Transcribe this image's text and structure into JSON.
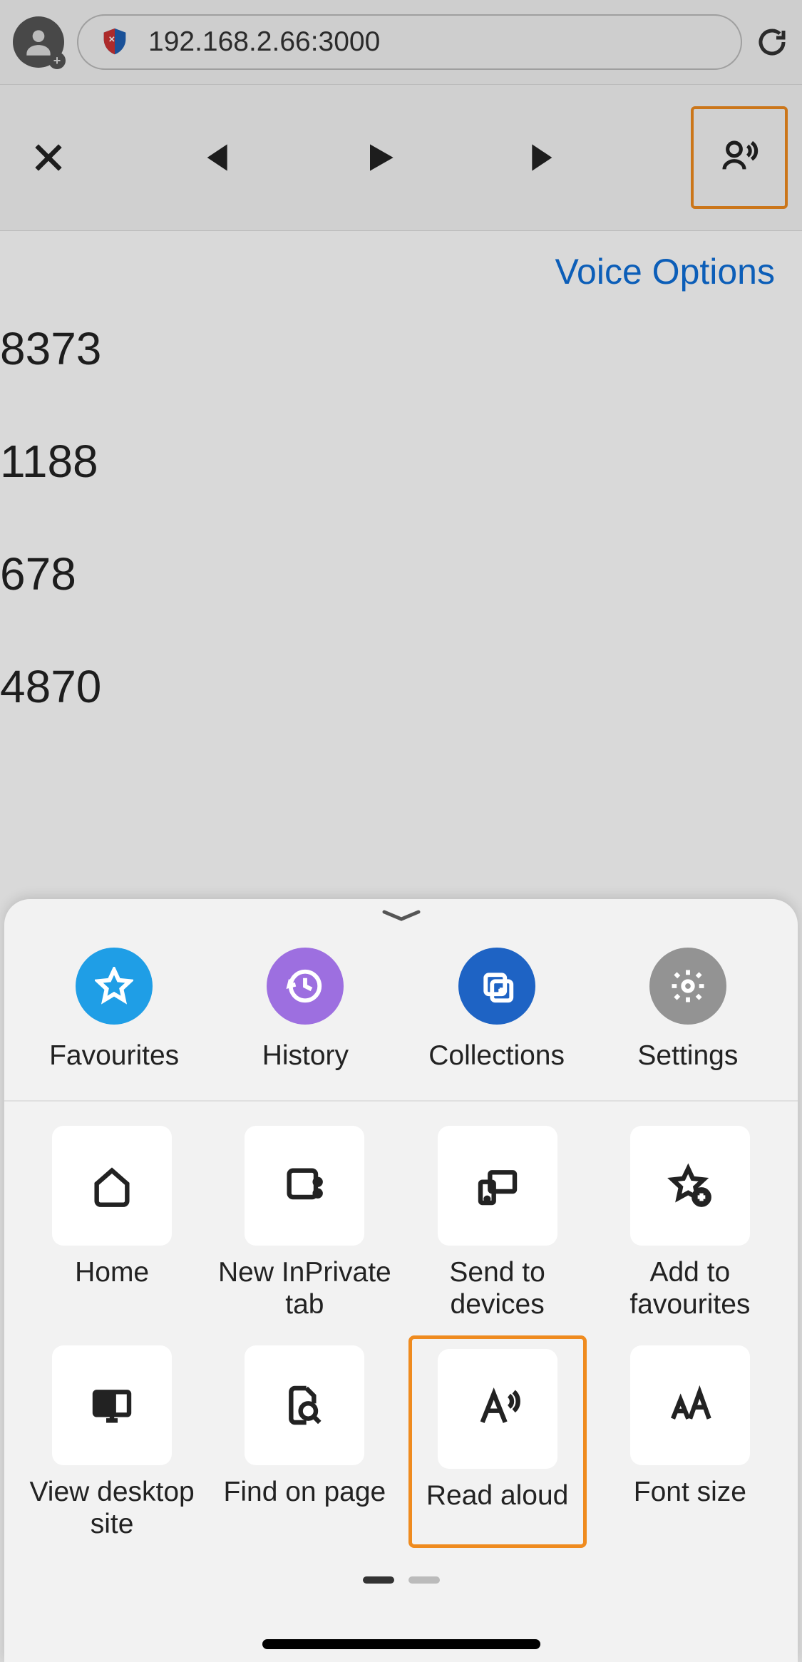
{
  "address_bar": {
    "url": "192.168.2.66:3000"
  },
  "voice_options_label": "Voice Options",
  "page_numbers": [
    "8373",
    "1188",
    "678",
    "4870"
  ],
  "top_row": {
    "favourites": "Favourites",
    "history": "History",
    "collections": "Collections",
    "settings": "Settings"
  },
  "grid": {
    "home": "Home",
    "new_inprivate": "New InPrivate tab",
    "send_devices": "Send to devices",
    "add_fav": "Add to favourites",
    "desktop": "View desktop site",
    "find": "Find on page",
    "read_aloud": "Read aloud",
    "font_size": "Font size"
  }
}
